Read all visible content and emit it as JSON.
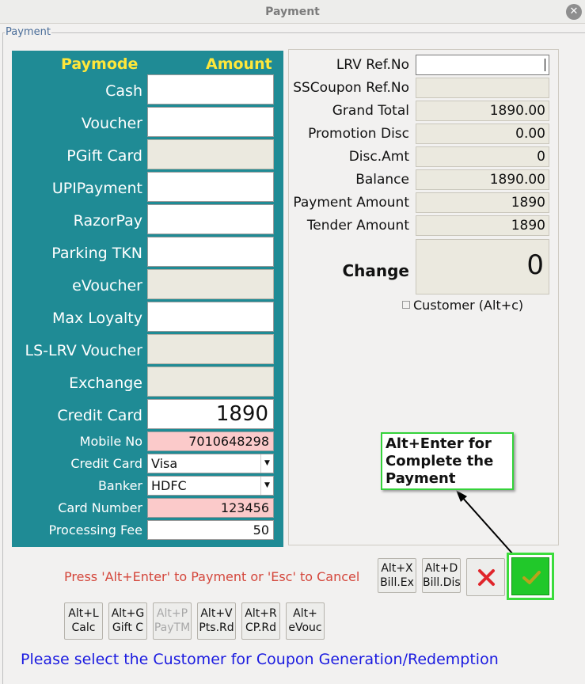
{
  "window": {
    "title": "Payment"
  },
  "group": {
    "title": "Payment"
  },
  "paymode": {
    "header_mode": "Paymode",
    "header_amount": "Amount",
    "rows": [
      {
        "label": "Cash",
        "value": "",
        "enabled": true
      },
      {
        "label": "Voucher",
        "value": "",
        "enabled": true
      },
      {
        "label": "PGift Card",
        "value": "",
        "enabled": false
      },
      {
        "label": "UPIPayment",
        "value": "",
        "enabled": true
      },
      {
        "label": "RazorPay",
        "value": "",
        "enabled": true
      },
      {
        "label": "Parking TKN",
        "value": "",
        "enabled": true
      },
      {
        "label": "eVoucher",
        "value": "",
        "enabled": false
      },
      {
        "label": "Max Loyalty",
        "value": "",
        "enabled": true
      },
      {
        "label": "LS-LRV Voucher",
        "value": "",
        "enabled": false
      },
      {
        "label": "Exchange",
        "value": "",
        "enabled": false
      },
      {
        "label": "Credit Card",
        "value": "1890",
        "enabled": true
      }
    ],
    "card_details": {
      "mobile_label": "Mobile No",
      "mobile_value": "7010648298",
      "card_type_label": "Credit Card",
      "card_type_value": "Visa",
      "banker_label": "Banker",
      "banker_value": "HDFC",
      "card_number_label": "Card Number",
      "card_number_value": "123456",
      "fee_label": "Processing Fee",
      "fee_value": "50"
    }
  },
  "summary": {
    "rows": [
      {
        "label": "LRV Ref.No",
        "value": ""
      },
      {
        "label": "SSCoupon Ref.No",
        "value": ""
      },
      {
        "label": "Grand Total",
        "value": "1890.00"
      },
      {
        "label": "Promotion Disc",
        "value": "0.00"
      },
      {
        "label": "Disc.Amt",
        "value": "0"
      },
      {
        "label": "Balance",
        "value": "1890.00"
      },
      {
        "label": "Payment Amount",
        "value": "1890"
      },
      {
        "label": "Tender Amount",
        "value": "1890"
      }
    ],
    "change_label": "Change",
    "change_value": "0",
    "customer_checkbox": "Customer (Alt+c)"
  },
  "callout": {
    "text_line1": "Alt+Enter for",
    "text_line2": "Complete the",
    "text_line3": "Payment"
  },
  "actions": {
    "message": "Press 'Alt+Enter' to Payment or 'Esc' to Cancel",
    "bill_ex": [
      "Alt+X",
      "Bill.Ex"
    ],
    "bill_dis": [
      "Alt+D",
      "Bill.Dis"
    ],
    "shortcuts": [
      {
        "line1": "Alt+L",
        "line2": "Calc",
        "enabled": true
      },
      {
        "line1": "Alt+G",
        "line2": "Gift C",
        "enabled": true
      },
      {
        "line1": "Alt+P",
        "line2": "PayTM",
        "enabled": false
      },
      {
        "line1": "Alt+V",
        "line2": "Pts.Rd",
        "enabled": true
      },
      {
        "line1": "Alt+R",
        "line2": "CP.Rd",
        "enabled": true
      },
      {
        "line1": "Alt+",
        "line2": "eVouc",
        "enabled": true
      }
    ]
  },
  "footer": {
    "message": "Please select the Customer for Coupon Generation/Redemption"
  },
  "colors": {
    "panel": "#1f8b95",
    "header": "#ffe73a",
    "pink_field": "#fbcaca",
    "ok_green": "#21c82a",
    "message_red": "#d4463b",
    "footer_blue": "#1b1be0"
  },
  "icons": {
    "close": "close-icon",
    "cancel": "x-icon",
    "ok": "checkmark-icon",
    "checkbox": "checkbox-icon"
  }
}
